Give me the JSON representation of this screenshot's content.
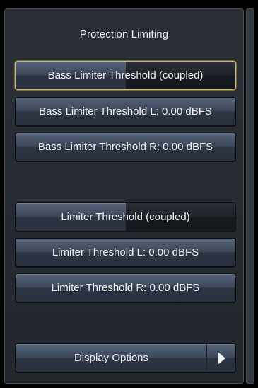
{
  "panel": {
    "title": "Protection Limiting"
  },
  "buttons": {
    "bass_coupled": "Bass Limiter Threshold (coupled)",
    "bass_left": "Bass Limiter Threshold L: 0.00 dBFS",
    "bass_right": "Bass Limiter Threshold R: 0.00 dBFS",
    "limiter_coupled": "Limiter Threshold (coupled)",
    "limiter_left": "Limiter Threshold L: 0.00 dBFS",
    "limiter_right": "Limiter Threshold R: 0.00 dBFS",
    "display_options": "Display Options"
  },
  "icons": {
    "display_options_arrow": "play-arrow-icon"
  },
  "colors": {
    "selection_outline": "#c9b870",
    "button_text": "#eef1f6"
  }
}
